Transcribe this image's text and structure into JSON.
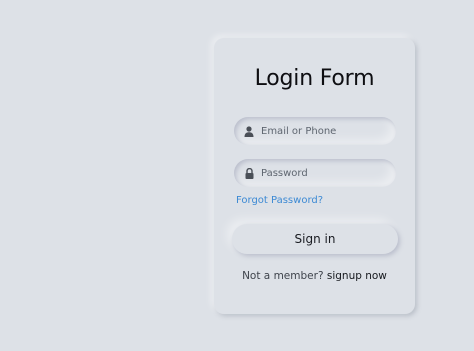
{
  "form": {
    "title": "Login Form",
    "email": {
      "placeholder": "Email or Phone",
      "value": "",
      "icon": "user-icon"
    },
    "password": {
      "placeholder": "Password",
      "value": "",
      "icon": "lock-icon"
    },
    "forgot_password_label": "Forgot Password?",
    "sign_in_label": "Sign in",
    "footer": {
      "prompt": "Not a member?",
      "signup_label": "signup now"
    }
  },
  "colors": {
    "background": "#dde1e7",
    "link": "#3d8ad4",
    "text": "#0e0e12"
  }
}
